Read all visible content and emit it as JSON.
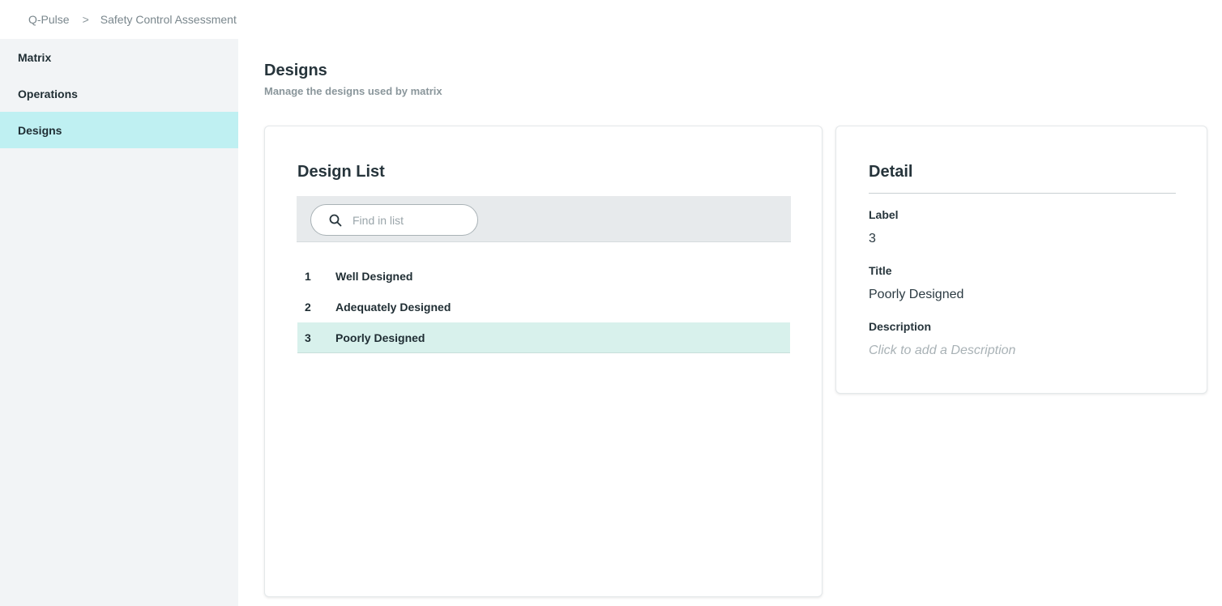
{
  "breadcrumb": {
    "items": [
      "Q-Pulse",
      "Safety Control Assessment"
    ],
    "separator": ">"
  },
  "sidebar": {
    "items": [
      {
        "label": "Matrix"
      },
      {
        "label": "Operations"
      },
      {
        "label": "Designs",
        "active": true
      }
    ]
  },
  "page": {
    "title": "Designs",
    "subtitle": "Manage the designs used by matrix"
  },
  "design_list": {
    "title": "Design List",
    "search": {
      "placeholder": "Find in list",
      "value": "",
      "icon": "search-icon"
    },
    "rows": [
      {
        "number": "1",
        "name": "Well Designed"
      },
      {
        "number": "2",
        "name": "Adequately Designed"
      },
      {
        "number": "3",
        "name": "Poorly Designed",
        "selected": true
      }
    ]
  },
  "detail": {
    "title": "Detail",
    "label_heading": "Label",
    "label_value": "3",
    "title_heading": "Title",
    "title_value": "Poorly Designed",
    "description_heading": "Description",
    "description_placeholder": "Click to add a Description"
  },
  "colors": {
    "sidebar_bg": "#f2f4f6",
    "sidebar_active": "#bff0f2",
    "row_selected": "#d8f1ec",
    "search_bar_bg": "#e7eaec"
  }
}
